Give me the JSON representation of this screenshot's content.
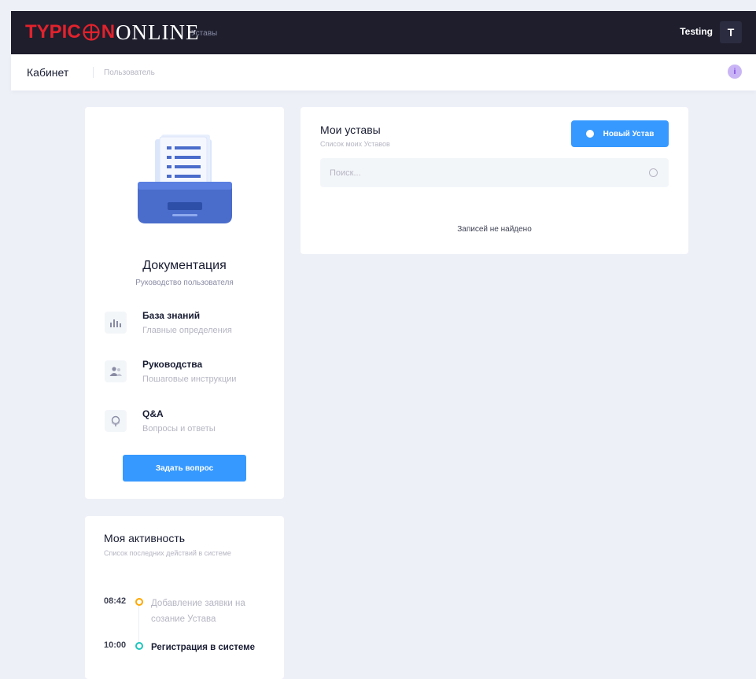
{
  "header": {
    "logo_typic": "TYPIC",
    "logo_n": "N",
    "logo_online": "ONLINE",
    "menu_item": "Уставы",
    "user_name": "Testing",
    "user_initial": "T"
  },
  "subheader": {
    "title": "Кабинет",
    "breadcrumb": "Пользователь",
    "info_icon": "i"
  },
  "docs": {
    "title": "Документация",
    "subtitle": "Руководство пользователя",
    "items": [
      {
        "title": "База знаний",
        "subtitle": "Главные определения",
        "icon": "chart-bars-icon"
      },
      {
        "title": "Руководства",
        "subtitle": "Пошаговые инструкции",
        "icon": "users-icon"
      },
      {
        "title": "Q&A",
        "subtitle": "Вопросы и ответы",
        "icon": "globe-icon"
      }
    ],
    "ask_button": "Задать вопрос"
  },
  "activity": {
    "title": "Моя активность",
    "subtitle": "Список последних действий в системе",
    "items": [
      {
        "time": "08:42",
        "text": "Добавление заявки на созание Устава",
        "color": "#ffa800"
      },
      {
        "time": "10:00",
        "text": "Регистрация в системе",
        "color": "#1bc5bd"
      }
    ]
  },
  "charters": {
    "title": "Мои уставы",
    "subtitle": "Список моих Уставов",
    "new_button": "Новый Устав",
    "search_placeholder": "Поиск...",
    "empty_text": "Записей не найдено"
  },
  "colors": {
    "header_bg": "#1e1e2d",
    "brand_red": "#e2222c",
    "primary": "#3699ff",
    "page_bg": "#eef0f8"
  }
}
